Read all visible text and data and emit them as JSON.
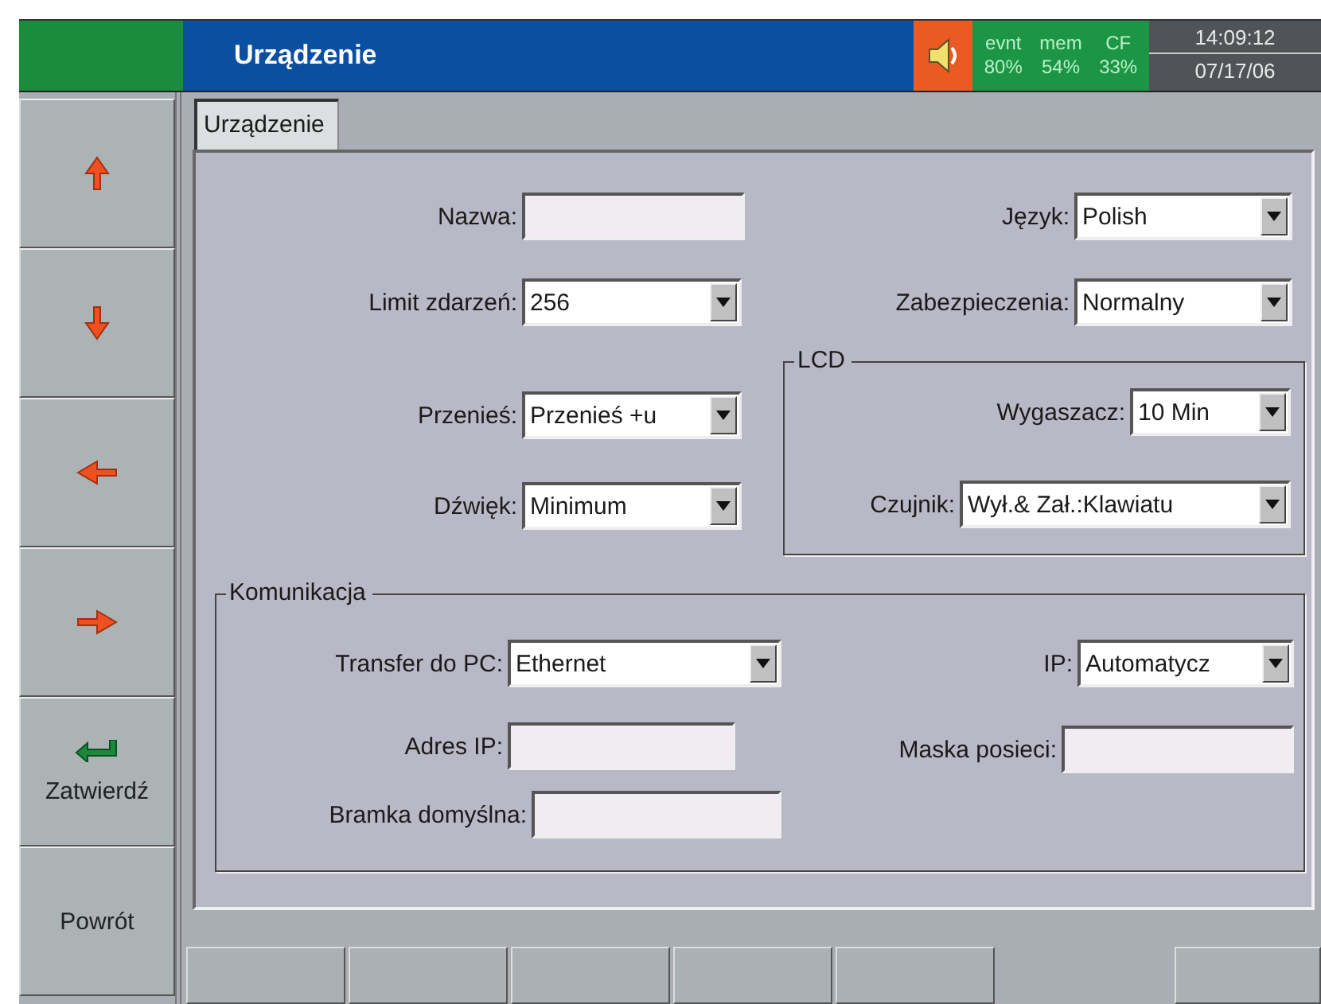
{
  "header": {
    "title": "Urządzenie",
    "alarm_sound": true,
    "stats": [
      {
        "label": "evnt",
        "value": "80%"
      },
      {
        "label": "mem",
        "value": "54%"
      },
      {
        "label": "CF",
        "value": "33%"
      }
    ],
    "time": "14:09:12",
    "date": "07/17/06"
  },
  "nav_buttons": [
    {
      "kind": "up"
    },
    {
      "kind": "down"
    },
    {
      "kind": "left"
    },
    {
      "kind": "right"
    },
    {
      "kind": "enter",
      "label": "Zatwierdź"
    },
    {
      "kind": "text",
      "label": "Powrót"
    }
  ],
  "tabs": [
    {
      "label": "Urządzenie",
      "selected": true
    }
  ],
  "form": {
    "left": [
      {
        "kind": "text",
        "label": "Nazwa:"
      },
      {
        "kind": "select",
        "label": "Limit zdarzeń:",
        "value": "256"
      },
      {
        "kind": "select",
        "label": "Przenieś:",
        "value": "Przenieś +u"
      },
      {
        "kind": "select",
        "label": "Dźwięk:",
        "value": "Minimum"
      }
    ],
    "right": [
      {
        "kind": "select",
        "label": "Język:",
        "value": "Polish"
      },
      {
        "kind": "select",
        "label": "Zabezpieczenia:",
        "value": "Normalny"
      }
    ],
    "lcd": {
      "title": "LCD",
      "fields": [
        {
          "kind": "select",
          "label": "Wygaszacz:",
          "value": "10 Min"
        },
        {
          "kind": "select",
          "label": "Czujnik:",
          "value": "Wył.& Zał.:Klawiatu"
        }
      ]
    },
    "communication": {
      "title": "Komunikacja",
      "left": [
        {
          "kind": "select",
          "label": "Transfer do PC:",
          "value": "Ethernet"
        },
        {
          "kind": "text",
          "label": "Adres IP:"
        },
        {
          "kind": "text",
          "label": "Bramka domyślna:"
        }
      ],
      "right": [
        {
          "kind": "select",
          "label": "IP:",
          "value": "Automatycz"
        },
        {
          "kind": "text",
          "label": "Maska posieci:"
        }
      ]
    }
  }
}
